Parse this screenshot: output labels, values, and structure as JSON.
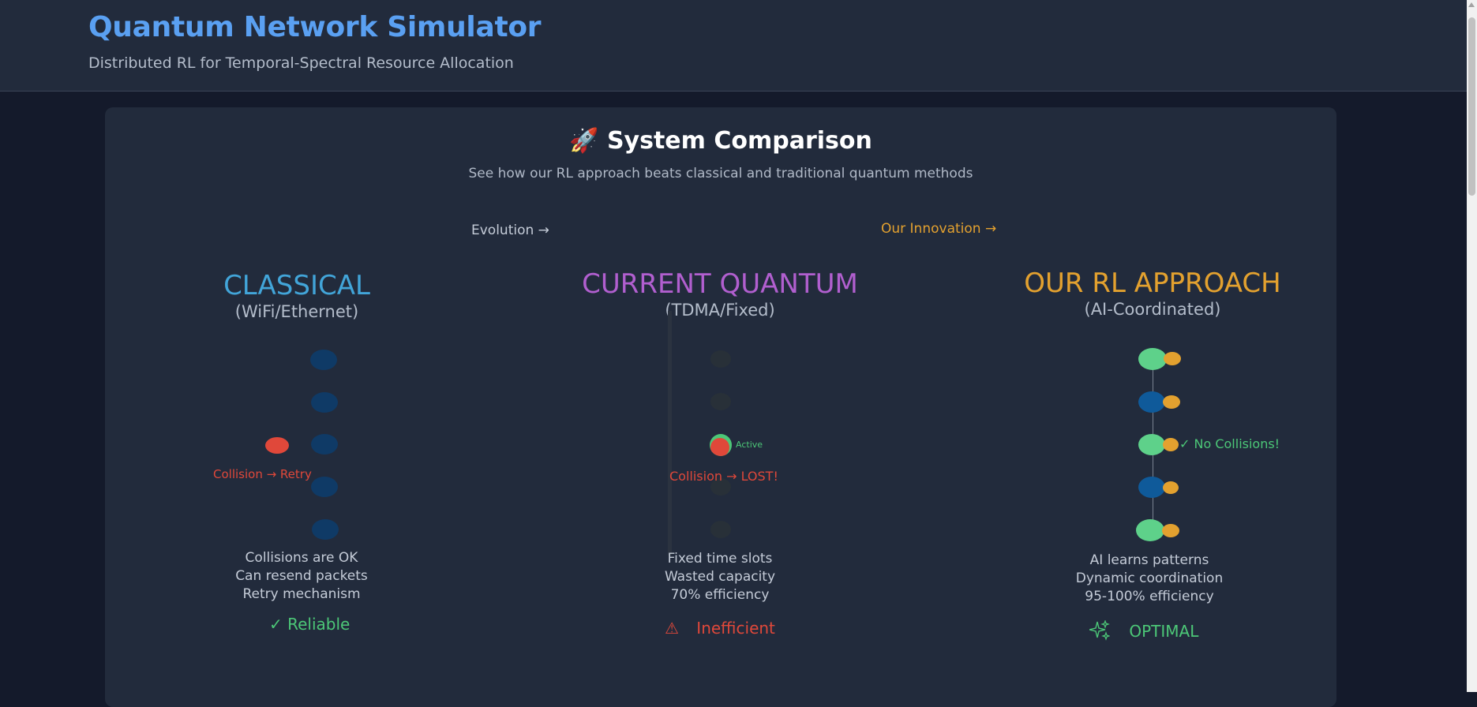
{
  "header": {
    "title": "Quantum Network Simulator",
    "subtitle": "Distributed RL for Temporal-Spectral Resource Allocation"
  },
  "comparison": {
    "title": "🚀 System Comparison",
    "subtitle": "See how our RL approach beats classical and traditional quantum methods",
    "evolution_label": "Evolution →",
    "innovation_label": "Our Innovation →",
    "columns": {
      "classical": {
        "title": "CLASSICAL",
        "subtitle": "(WiFi/Ethernet)",
        "collision_label": "Collision → Retry",
        "features": [
          "Collisions are OK",
          "Can resend packets",
          "Retry mechanism"
        ],
        "status_icon": "checkmark-icon",
        "status_glyph": "✓",
        "status_text": "Reliable"
      },
      "quantum": {
        "title": "CURRENT QUANTUM",
        "subtitle": "(TDMA/Fixed)",
        "active_label": "Active",
        "collision_label": "Collision → LOST!",
        "features": [
          "Fixed time slots",
          "Wasted capacity",
          "70% efficiency"
        ],
        "status_icon": "warning-icon",
        "status_glyph": "⚠",
        "status_text": "Inefficient"
      },
      "rl": {
        "title": "OUR RL APPROACH",
        "subtitle": "(AI-Coordinated)",
        "no_collision_label": "✓ No Collisions!",
        "features": [
          "AI learns patterns",
          "Dynamic coordination",
          "95-100% efficiency"
        ],
        "status_icon": "sparkles-icon",
        "status_text": "OPTIMAL"
      }
    }
  },
  "colors": {
    "classical": "#42a5d9",
    "quantum": "#b15fcf",
    "rl": "#e3a12f",
    "success": "#4cc777",
    "danger": "#e0483a"
  }
}
